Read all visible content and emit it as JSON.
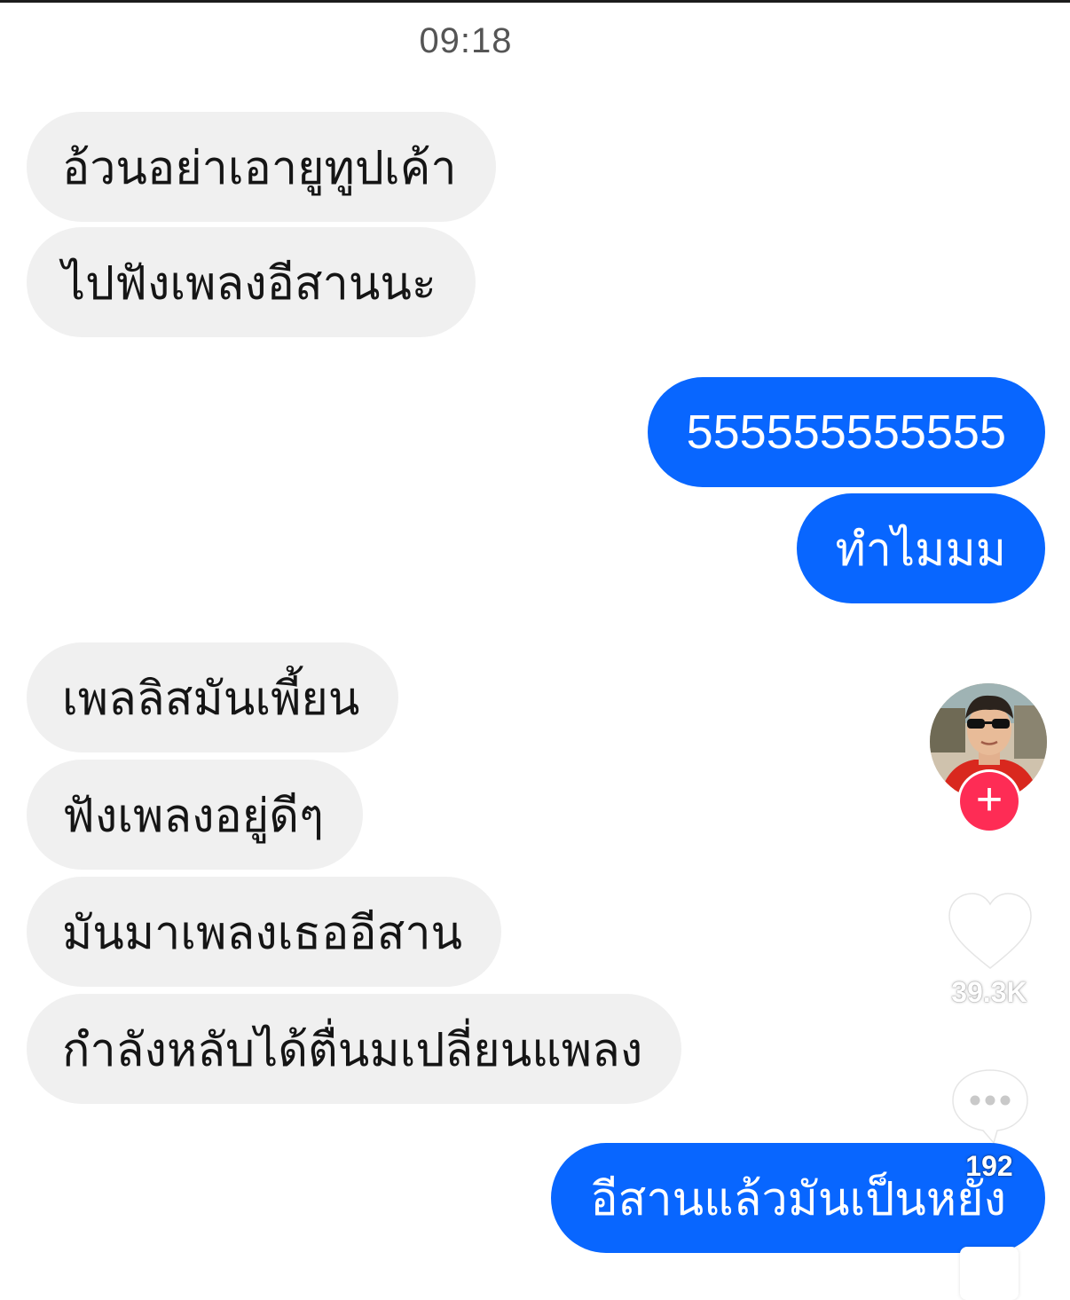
{
  "timestamp": "09:18",
  "messages": [
    {
      "side": "in",
      "text": "อ้วนอย่าเอายูทูปเค้า"
    },
    {
      "side": "in",
      "text": "ไปฟังเพลงอีสานนะ"
    },
    {
      "side": "out",
      "text": "555555555555"
    },
    {
      "side": "out",
      "text": "ทำไมมม"
    },
    {
      "side": "in",
      "text": "เพลลิสมันเพี้ยน"
    },
    {
      "side": "in",
      "text": "ฟังเพลงอยู่ดีๆ"
    },
    {
      "side": "in",
      "text": "มันมาเพลงเธออีสาน"
    },
    {
      "side": "in",
      "text": "กำลังหลับได้ตื่นมเปลี่ยนแพลง"
    },
    {
      "side": "out",
      "text": "อีสานแล้วมันเป็นหยัง"
    }
  ],
  "overlay": {
    "follow_label": "+",
    "like_count": "39.3K",
    "comment_count": "192",
    "icons": [
      "profile-avatar",
      "plus-icon",
      "heart-icon",
      "comment-icon"
    ]
  },
  "colors": {
    "outgoing_bubble": "#0866ff",
    "incoming_bubble": "#f0f0f0",
    "follow_button": "#fe2c55"
  }
}
